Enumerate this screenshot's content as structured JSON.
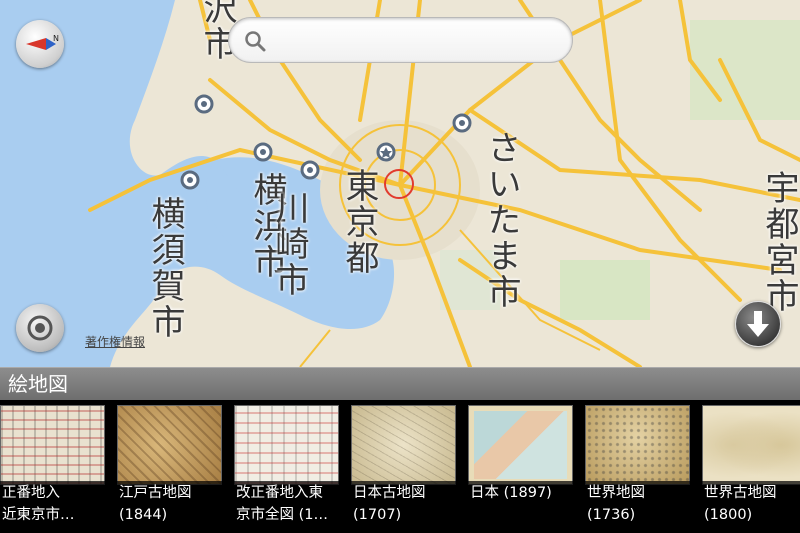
{
  "map": {
    "labels": {
      "city_top": "沢市",
      "yokohama": "横浜市",
      "kawasaki": "川崎市",
      "tokyo": "東京都",
      "saitama": "さいたま市",
      "yokosuka": "横須賀市",
      "utsunomiya": "宇都宮市"
    },
    "copyright": "著作権情報"
  },
  "search": {
    "value": "",
    "placeholder": ""
  },
  "section": {
    "title": "絵地図"
  },
  "items": [
    {
      "line1": "正番地入",
      "line2": "近東京市…",
      "style": "red-grid"
    },
    {
      "line1": "江戸古地図",
      "line2": "(1844)",
      "style": "sepia"
    },
    {
      "line1": "改正番地入東",
      "line2": "京市全図 (1…",
      "style": "red-grid-light"
    },
    {
      "line1": "日本古地図",
      "line2": "(1707)",
      "style": "parchment"
    },
    {
      "line1": "日本 (1897)",
      "line2": "",
      "style": "blue-map"
    },
    {
      "line1": "世界地図",
      "line2": "(1736)",
      "style": "sepia-dots"
    },
    {
      "line1": "世界古地図",
      "line2": "(1800)",
      "style": "parchment-light"
    }
  ],
  "colors": {
    "water": "#a9cdf0",
    "land": "#ece6d6",
    "road": "#f5c23a",
    "header": "#7c7c7c"
  }
}
